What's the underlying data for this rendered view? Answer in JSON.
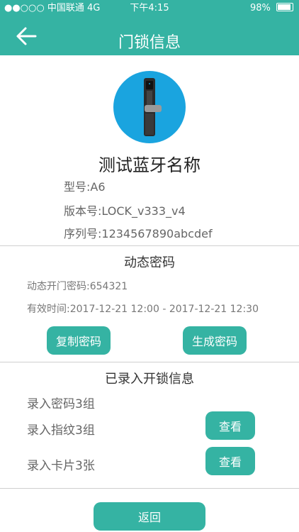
{
  "status_bar": {
    "carrier": "●●○○○ 中国联通  4G",
    "time": "下午4:15",
    "battery": "98%"
  },
  "header": {
    "title": "门锁信息"
  },
  "device": {
    "name": "测试蓝牙名称",
    "model": "型号:A6",
    "version": "版本号:LOCK_v333_v4",
    "serial": "序列号:1234567890abcdef"
  },
  "dynamic_password": {
    "title": "动态密码",
    "code": "动态开门密码:654321",
    "valid": "有效时间:2017-12-21 12:00 - 2017-12-21 12:30",
    "copy_button": "复制密码",
    "generate_button": "生成密码"
  },
  "unlock_info": {
    "title": "已录入开锁信息",
    "passwords": "录入密码3组",
    "fingerprints": "录入指纹3组",
    "cards": "录入卡片3张",
    "view_fingerprints_button": "查看",
    "view_cards_button": "查看"
  },
  "footer": {
    "back_button": "返回"
  },
  "colors": {
    "primary": "#35b3a3",
    "avatar_bg": "#1aa4df"
  }
}
